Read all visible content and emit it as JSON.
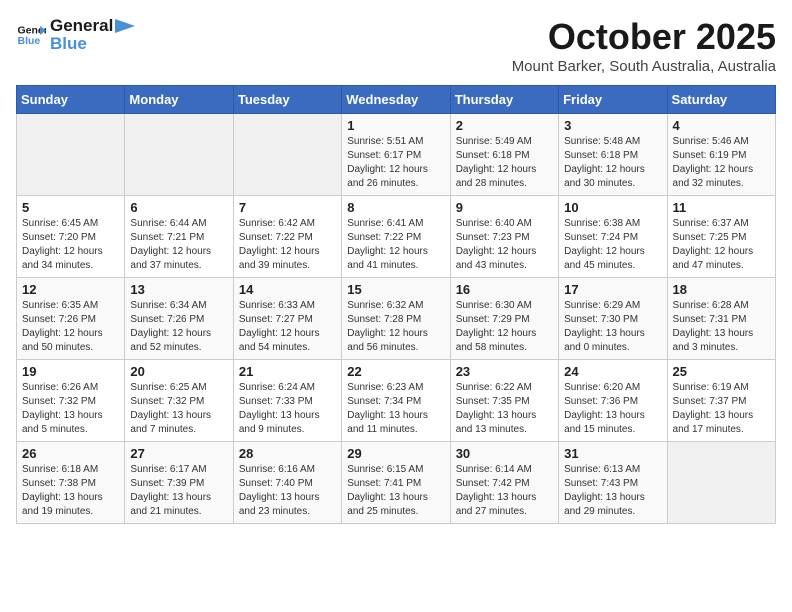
{
  "logo": {
    "line1": "General",
    "line2": "Blue"
  },
  "title": "October 2025",
  "location": "Mount Barker, South Australia, Australia",
  "headers": [
    "Sunday",
    "Monday",
    "Tuesday",
    "Wednesday",
    "Thursday",
    "Friday",
    "Saturday"
  ],
  "weeks": [
    [
      {
        "day": "",
        "content": ""
      },
      {
        "day": "",
        "content": ""
      },
      {
        "day": "",
        "content": ""
      },
      {
        "day": "1",
        "content": "Sunrise: 5:51 AM\nSunset: 6:17 PM\nDaylight: 12 hours\nand 26 minutes."
      },
      {
        "day": "2",
        "content": "Sunrise: 5:49 AM\nSunset: 6:18 PM\nDaylight: 12 hours\nand 28 minutes."
      },
      {
        "day": "3",
        "content": "Sunrise: 5:48 AM\nSunset: 6:18 PM\nDaylight: 12 hours\nand 30 minutes."
      },
      {
        "day": "4",
        "content": "Sunrise: 5:46 AM\nSunset: 6:19 PM\nDaylight: 12 hours\nand 32 minutes."
      }
    ],
    [
      {
        "day": "5",
        "content": "Sunrise: 6:45 AM\nSunset: 7:20 PM\nDaylight: 12 hours\nand 34 minutes."
      },
      {
        "day": "6",
        "content": "Sunrise: 6:44 AM\nSunset: 7:21 PM\nDaylight: 12 hours\nand 37 minutes."
      },
      {
        "day": "7",
        "content": "Sunrise: 6:42 AM\nSunset: 7:22 PM\nDaylight: 12 hours\nand 39 minutes."
      },
      {
        "day": "8",
        "content": "Sunrise: 6:41 AM\nSunset: 7:22 PM\nDaylight: 12 hours\nand 41 minutes."
      },
      {
        "day": "9",
        "content": "Sunrise: 6:40 AM\nSunset: 7:23 PM\nDaylight: 12 hours\nand 43 minutes."
      },
      {
        "day": "10",
        "content": "Sunrise: 6:38 AM\nSunset: 7:24 PM\nDaylight: 12 hours\nand 45 minutes."
      },
      {
        "day": "11",
        "content": "Sunrise: 6:37 AM\nSunset: 7:25 PM\nDaylight: 12 hours\nand 47 minutes."
      }
    ],
    [
      {
        "day": "12",
        "content": "Sunrise: 6:35 AM\nSunset: 7:26 PM\nDaylight: 12 hours\nand 50 minutes."
      },
      {
        "day": "13",
        "content": "Sunrise: 6:34 AM\nSunset: 7:26 PM\nDaylight: 12 hours\nand 52 minutes."
      },
      {
        "day": "14",
        "content": "Sunrise: 6:33 AM\nSunset: 7:27 PM\nDaylight: 12 hours\nand 54 minutes."
      },
      {
        "day": "15",
        "content": "Sunrise: 6:32 AM\nSunset: 7:28 PM\nDaylight: 12 hours\nand 56 minutes."
      },
      {
        "day": "16",
        "content": "Sunrise: 6:30 AM\nSunset: 7:29 PM\nDaylight: 12 hours\nand 58 minutes."
      },
      {
        "day": "17",
        "content": "Sunrise: 6:29 AM\nSunset: 7:30 PM\nDaylight: 13 hours\nand 0 minutes."
      },
      {
        "day": "18",
        "content": "Sunrise: 6:28 AM\nSunset: 7:31 PM\nDaylight: 13 hours\nand 3 minutes."
      }
    ],
    [
      {
        "day": "19",
        "content": "Sunrise: 6:26 AM\nSunset: 7:32 PM\nDaylight: 13 hours\nand 5 minutes."
      },
      {
        "day": "20",
        "content": "Sunrise: 6:25 AM\nSunset: 7:32 PM\nDaylight: 13 hours\nand 7 minutes."
      },
      {
        "day": "21",
        "content": "Sunrise: 6:24 AM\nSunset: 7:33 PM\nDaylight: 13 hours\nand 9 minutes."
      },
      {
        "day": "22",
        "content": "Sunrise: 6:23 AM\nSunset: 7:34 PM\nDaylight: 13 hours\nand 11 minutes."
      },
      {
        "day": "23",
        "content": "Sunrise: 6:22 AM\nSunset: 7:35 PM\nDaylight: 13 hours\nand 13 minutes."
      },
      {
        "day": "24",
        "content": "Sunrise: 6:20 AM\nSunset: 7:36 PM\nDaylight: 13 hours\nand 15 minutes."
      },
      {
        "day": "25",
        "content": "Sunrise: 6:19 AM\nSunset: 7:37 PM\nDaylight: 13 hours\nand 17 minutes."
      }
    ],
    [
      {
        "day": "26",
        "content": "Sunrise: 6:18 AM\nSunset: 7:38 PM\nDaylight: 13 hours\nand 19 minutes."
      },
      {
        "day": "27",
        "content": "Sunrise: 6:17 AM\nSunset: 7:39 PM\nDaylight: 13 hours\nand 21 minutes."
      },
      {
        "day": "28",
        "content": "Sunrise: 6:16 AM\nSunset: 7:40 PM\nDaylight: 13 hours\nand 23 minutes."
      },
      {
        "day": "29",
        "content": "Sunrise: 6:15 AM\nSunset: 7:41 PM\nDaylight: 13 hours\nand 25 minutes."
      },
      {
        "day": "30",
        "content": "Sunrise: 6:14 AM\nSunset: 7:42 PM\nDaylight: 13 hours\nand 27 minutes."
      },
      {
        "day": "31",
        "content": "Sunrise: 6:13 AM\nSunset: 7:43 PM\nDaylight: 13 hours\nand 29 minutes."
      },
      {
        "day": "",
        "content": ""
      }
    ]
  ]
}
